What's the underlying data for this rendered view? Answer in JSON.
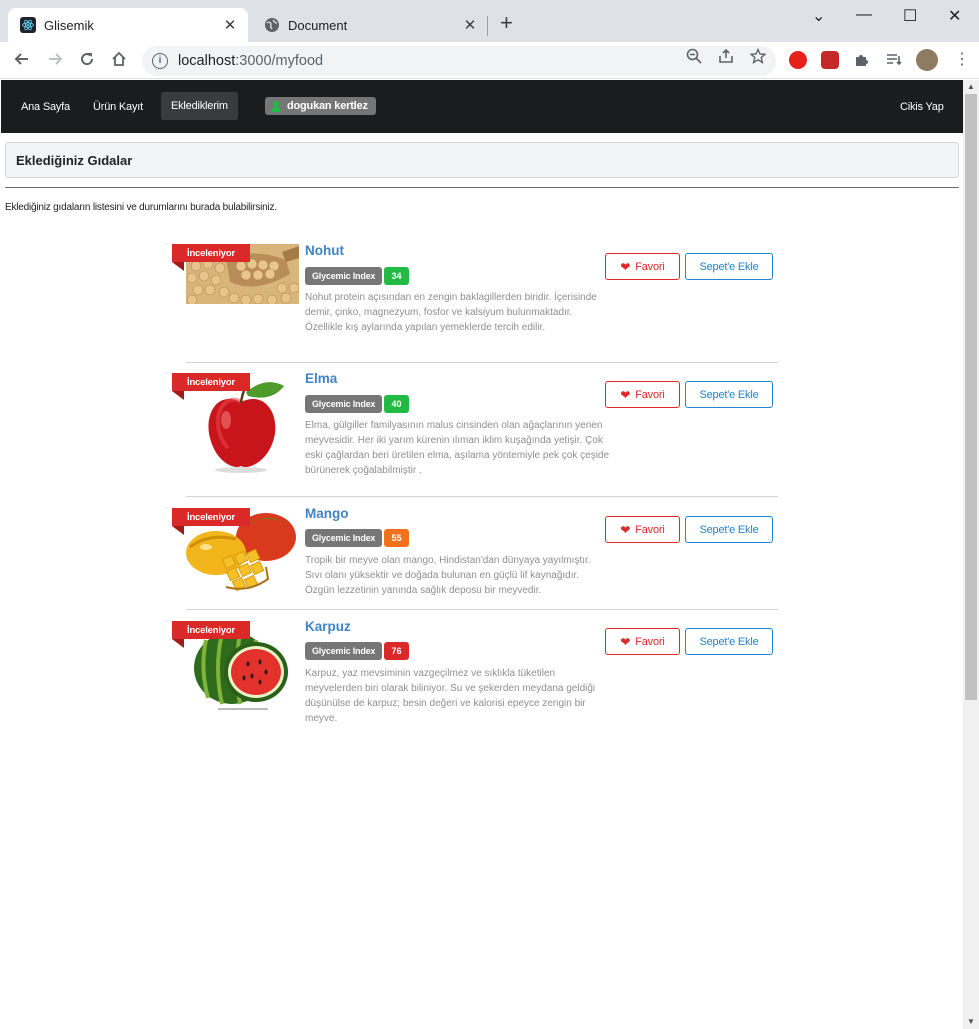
{
  "browser": {
    "tabs": [
      {
        "title": "Glisemik",
        "active": true,
        "close": "✕"
      },
      {
        "title": "Document",
        "active": false,
        "close": "✕"
      }
    ],
    "new_tab": "+",
    "url_host": "localhost",
    "url_rest": ":3000/myfood",
    "controls": {
      "minimize": "—",
      "maximize": "☐",
      "close": "✕",
      "chevron": "⌄"
    }
  },
  "nav": {
    "items": [
      "Ana Sayfa",
      "Ürün Kayıt",
      "Eklediklerim"
    ],
    "user": "dogukan kertlez",
    "logout": "Cikis Yap"
  },
  "page": {
    "header": "Eklediğiniz Gıdalar",
    "description": "Eklediğiniz gıdaların listesini ve durumlarını burada bulabilirsiniz."
  },
  "labels": {
    "status": "İnceleniyor",
    "gi": "Glycemic Index",
    "favorite": "Favori",
    "add_to_cart": "Sepet'e Ekle"
  },
  "foods": [
    {
      "name": "Nohut",
      "gi": "34",
      "gi_color": "#21ba45",
      "text": "Nohut protein açısından en zengin baklagillerden biridir. İçerisinde demir, çinko, magnezyum, fosfor ve kalsiyum bulunmaktadır. Özellikle kış aylarında yapılan yemeklerde tercih edilir."
    },
    {
      "name": "Elma",
      "gi": "40",
      "gi_color": "#21ba45",
      "text": "Elma, gülgiller familyasının malus cinsinden olan ağaçlarının yenen meyvesidir. Her iki yarım kürenin ılıman iklim kuşağında yetişir. Çok eski çağlardan beri üretilen elma, aşılama yöntemiyle pek çok çeşide bürünerek çoğalabilmiştir ."
    },
    {
      "name": "Mango",
      "gi": "55",
      "gi_color": "#f2711c",
      "text": "Tropik bir meyve olan mango, Hindistan'dan dünyaya yayılmıştır. Sıvı olanı yüksektir ve doğada bulunan en güçlü lif kaynağıdır. Özgün lezzetinin yanında sağlık deposu bir meyvedir."
    },
    {
      "name": "Karpuz",
      "gi": "76",
      "gi_color": "#db2828",
      "text": "Karpuz, yaz mevsiminin vazgeçilmez ve sıklıkla tüketilen meyvelerden biri olarak biliniyor. Su ve şekerden meydana geldiği düşünülse de karpuz; besin değeri ve kalorisi epeyce zengin bir meyve."
    }
  ]
}
